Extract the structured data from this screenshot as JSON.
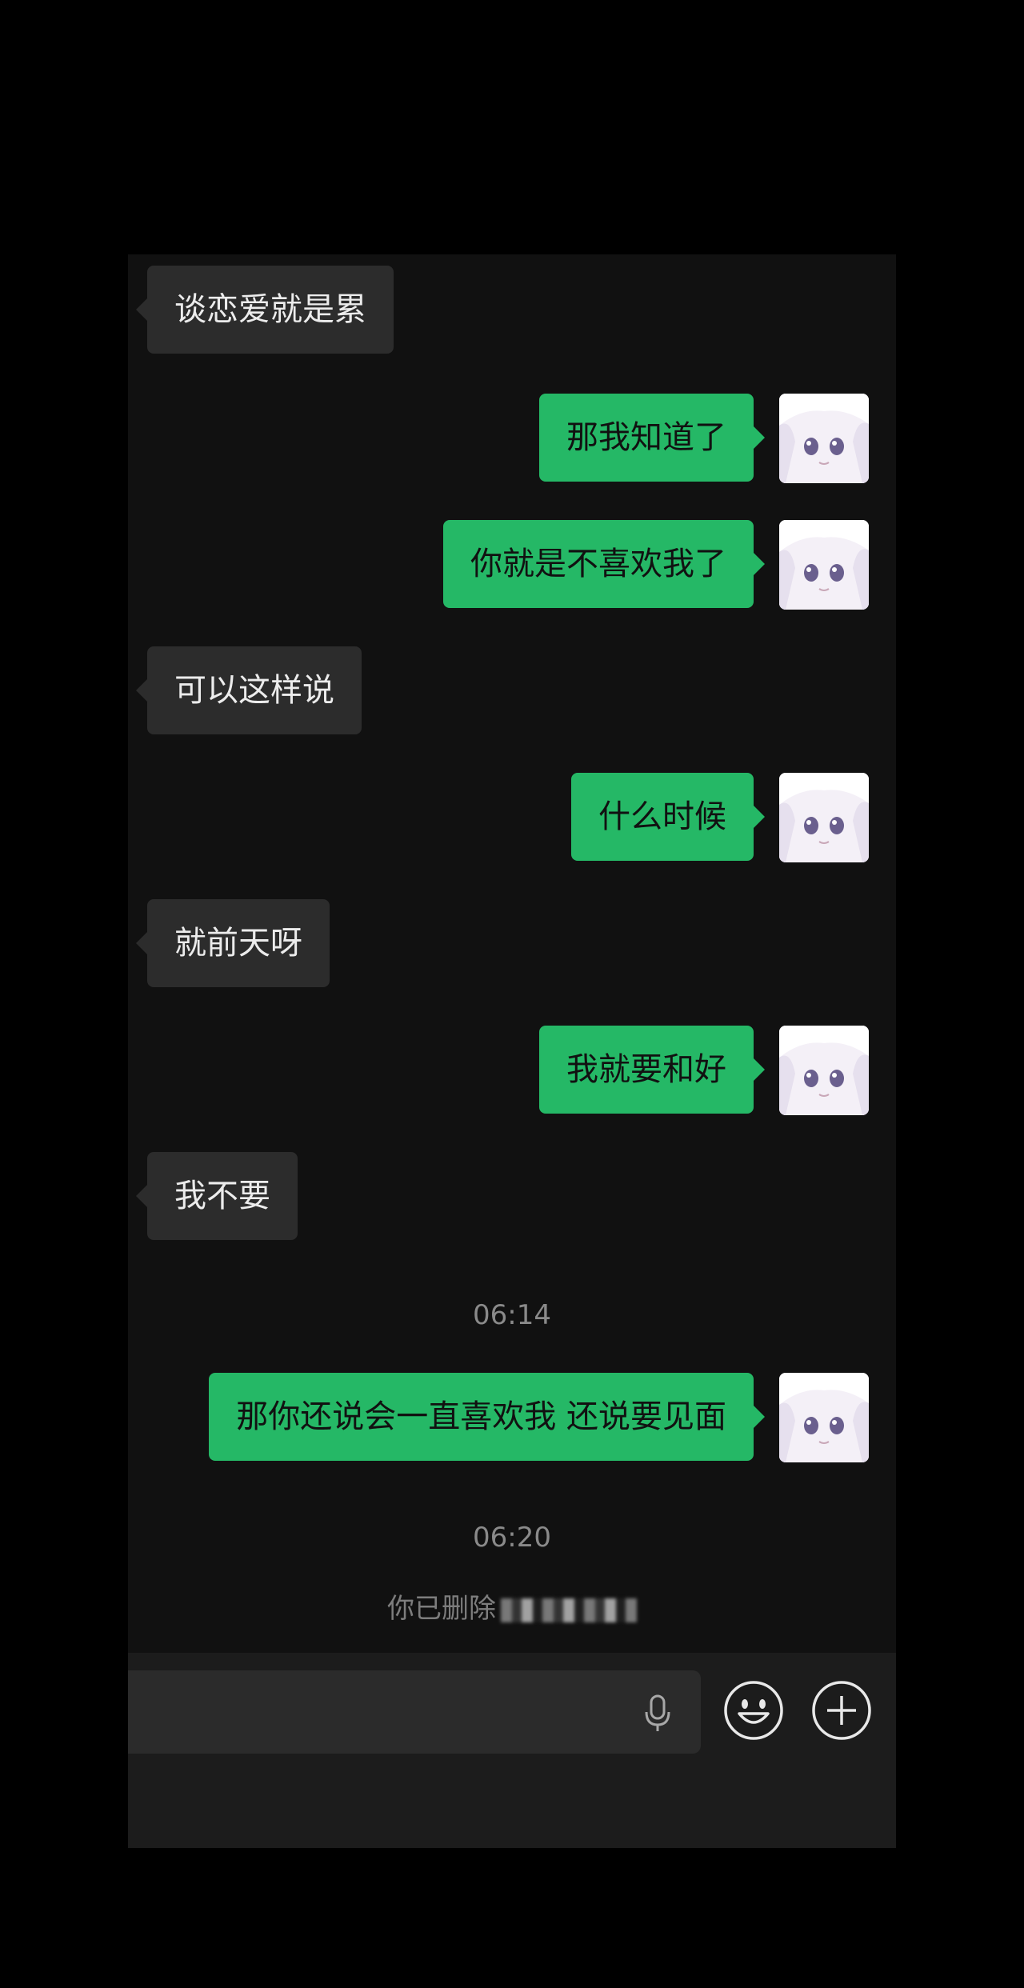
{
  "messages": [
    {
      "side": "in",
      "text": "谈恋爱就是累"
    },
    {
      "side": "out",
      "text": "那我知道了"
    },
    {
      "side": "out",
      "text": "你就是不喜欢我了"
    },
    {
      "side": "in",
      "text": "可以这样说"
    },
    {
      "side": "out",
      "text": "什么时候"
    },
    {
      "side": "in",
      "text": "就前天呀"
    },
    {
      "side": "out",
      "text": "我就要和好"
    },
    {
      "side": "in",
      "text": "我不要"
    },
    {
      "side": "out",
      "text": "那你还说会一直喜欢我 还说要见面"
    }
  ],
  "timestamps": [
    "06:14",
    "06:20"
  ],
  "system_notice": "你已删除",
  "colors": {
    "outgoing_bubble": "#25b866",
    "incoming_bubble": "#2c2c2c",
    "chat_background": "#111111",
    "input_bar": "#1c1c1c"
  },
  "icons": {
    "voice": "microphone-icon",
    "emoji": "emoji-icon",
    "more": "plus-icon"
  }
}
